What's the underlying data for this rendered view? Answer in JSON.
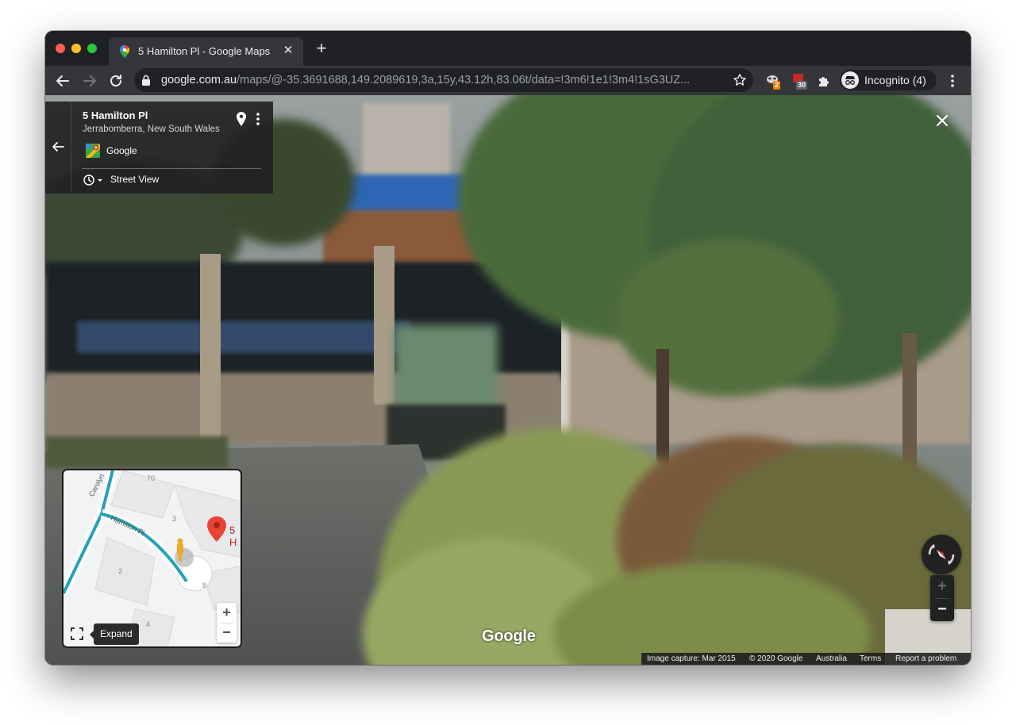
{
  "browser": {
    "tab_title": "5 Hamilton Pl - Google Maps",
    "url_host": "google.com.au",
    "url_path": "/maps/@-35.3691688,149.2089619,3a,15y,43.12h,83.06t/data=!3m6!1e1!3m4!1sG3UZ...",
    "extensions": [
      {
        "name": "extension-1",
        "badge": "2",
        "badge_color": "#f57c00"
      },
      {
        "name": "extension-2",
        "badge": "30",
        "badge_color": "#5f6368"
      }
    ],
    "profile_label": "Incognito (4)"
  },
  "place": {
    "title": "5 Hamilton Pl",
    "subtitle": "Jerrabomberra, New South Wales",
    "source": "Google",
    "view_type": "Street View"
  },
  "minimap": {
    "streets": [
      "Carolyn",
      "Hamilton Pl"
    ],
    "lot_numbers": [
      "70",
      "3",
      "2",
      "8",
      "4"
    ],
    "marker_label": "5 H",
    "expand_tooltip": "Expand",
    "zoom_in": "+",
    "zoom_out": "−"
  },
  "controls": {
    "zoom_in": "+",
    "zoom_out": "−"
  },
  "watermark": "Google",
  "footer": {
    "capture": "Image capture: Mar 2015",
    "copyright": "© 2020 Google",
    "country": "Australia",
    "terms": "Terms",
    "report": "Report a problem"
  },
  "colors": {
    "accent_teal": "#26a2b5",
    "marker_red": "#ea4335",
    "pegman": "#f5a623"
  }
}
